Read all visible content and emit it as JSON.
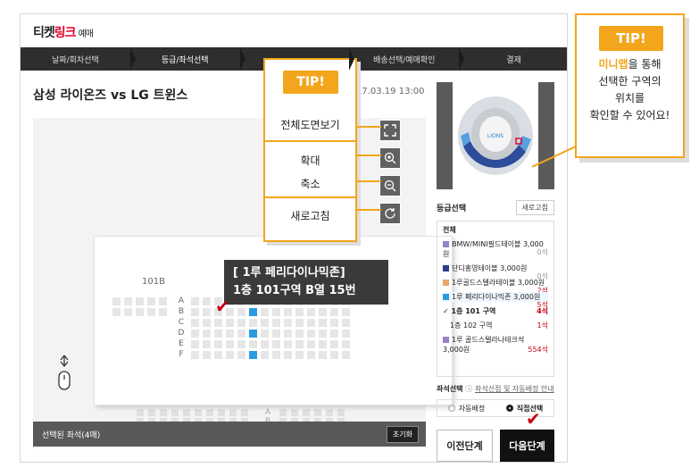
{
  "header": {
    "logo_main": "티켓",
    "logo_red": "링크",
    "logo_sub": "예매"
  },
  "steps": [
    "날짜/회차선택",
    "등급/좌석선택",
    "",
    "배송선택/예매확인",
    "결제"
  ],
  "event": {
    "title": "삼성 라이온즈 vs LG 트윈스",
    "date": "17.03.19 13:00"
  },
  "tip_tools": {
    "badge": "TIP!",
    "full_view": "전체도면보기",
    "zoom_in": "확대",
    "zoom_out": "축소",
    "refresh": "새로고침"
  },
  "tool_icons": [
    "fullscreen-icon",
    "zoom-in-icon",
    "zoom-out-icon",
    "refresh-icon"
  ],
  "seatmap": {
    "block": "101B",
    "block_lower": "101B",
    "rows": [
      "A",
      "B",
      "C",
      "D",
      "E",
      "F"
    ],
    "rows_lower": [
      "A",
      "B",
      "C",
      "D"
    ],
    "tooltip_line1": "[ 1루 페리다이나믹존]",
    "tooltip_line2": "1층 101구역 B열 15번"
  },
  "bottom_bar": {
    "label": "선택된 좌석(4매)",
    "reset": "초기화"
  },
  "sidebar": {
    "grade_title": "등급선택",
    "refresh": "새로고침",
    "grades": [
      {
        "name": "전체",
        "price": "",
        "count": "",
        "color": ""
      },
      {
        "name": "BMW/MINI필드테이블",
        "price": "3,000원",
        "count": "0석",
        "color": "#8b86c8"
      },
      {
        "name": "단디홍영테이블",
        "price": "3,000원",
        "count": "0석",
        "color": "#2b3f8c"
      },
      {
        "name": "1루골드스텔라테이블",
        "price": "3,000원",
        "count": "2석",
        "color": "#e8a76b"
      },
      {
        "name": "1루 페리다이나믹존",
        "price": "3,000원",
        "count": "5석",
        "color": "#2a9be0"
      },
      {
        "name": "1층 101 구역",
        "price": "",
        "count": "4석",
        "color": ""
      },
      {
        "name": "1층 102 구역",
        "price": "",
        "count": "1석",
        "color": ""
      },
      {
        "name": "1루 골드스텔라나테크석",
        "price": "3,000원",
        "count": "554석",
        "color": "#9a82c4"
      }
    ],
    "seat_select_title": "좌석선택",
    "seat_select_help": "좌석선점 및 자동배정 안내",
    "auto_assign": "자동배정",
    "direct_select": "직접선택",
    "prev": "이전단계",
    "next": "다음단계"
  },
  "tip_minimap": {
    "badge": "TIP!",
    "highlight": "미니맵",
    "line1": "을 통해",
    "line2": "선택한 구역의",
    "line3": "위치를",
    "line4": "확인할 수 있어요!"
  }
}
